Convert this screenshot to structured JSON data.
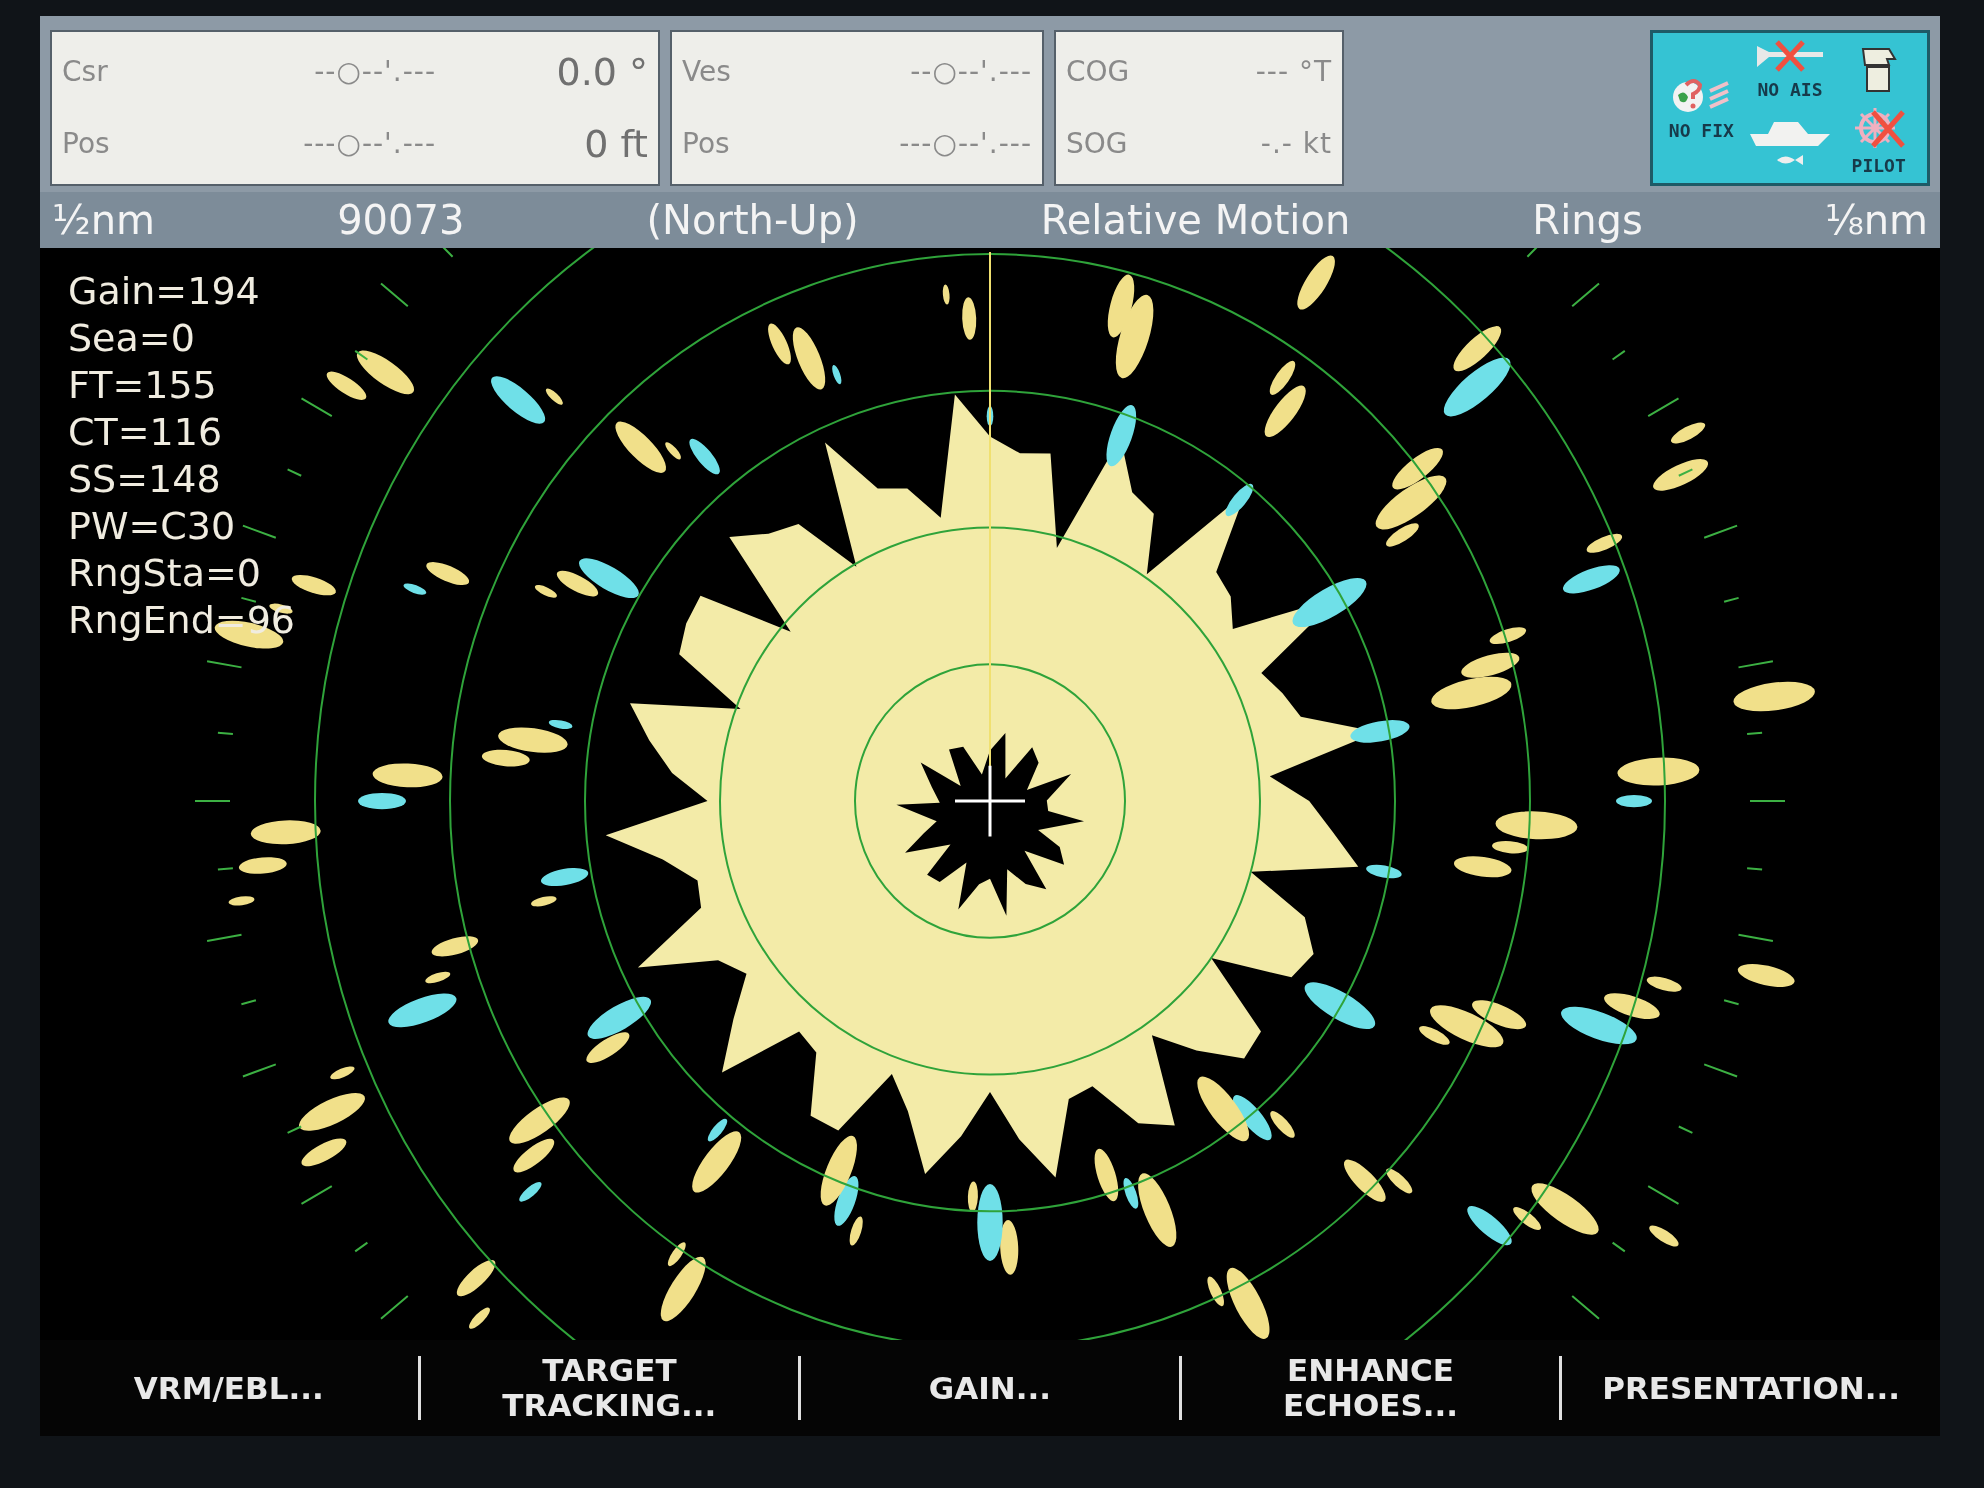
{
  "readout_panels": [
    {
      "rows": [
        {
          "label": "Csr",
          "coordinate": "--○--'.---",
          "value": "0.0 °"
        },
        {
          "label": "Pos",
          "coordinate": "---○--'.---",
          "value": "0 ft"
        }
      ]
    },
    {
      "rows": [
        {
          "label": "Ves",
          "coordinate": "--○--'.---"
        },
        {
          "label": "Pos",
          "coordinate": "---○--'.---"
        }
      ]
    },
    {
      "rows": [
        {
          "label": "COG",
          "coordinate": "---  °T"
        },
        {
          "label": "SOG",
          "coordinate": "-.- kt"
        }
      ]
    }
  ],
  "status_indicators": [
    {
      "kind": "fix",
      "label": "NO FIX"
    },
    {
      "kind": "ais",
      "label": "NO AIS"
    },
    {
      "kind": "pilot",
      "label": "PILOT"
    }
  ],
  "status_bar": {
    "range": "½nm",
    "gain_value": "90073",
    "orientation": "(North-Up)",
    "motion": "Relative Motion",
    "rings_label": "Rings",
    "ring_interval": "⅛nm"
  },
  "radar_settings": [
    "Gain=194",
    "Sea=0",
    "FT=155",
    "CT=116",
    "SS=148",
    "PW=C30",
    "RngSta=0",
    "RngEnd=96"
  ],
  "softkeys": [
    "VRM/EBL...",
    "TARGET\nTRACKING...",
    "GAIN...",
    "ENHANCE\nECHOES...",
    "PRESENTATION..."
  ]
}
